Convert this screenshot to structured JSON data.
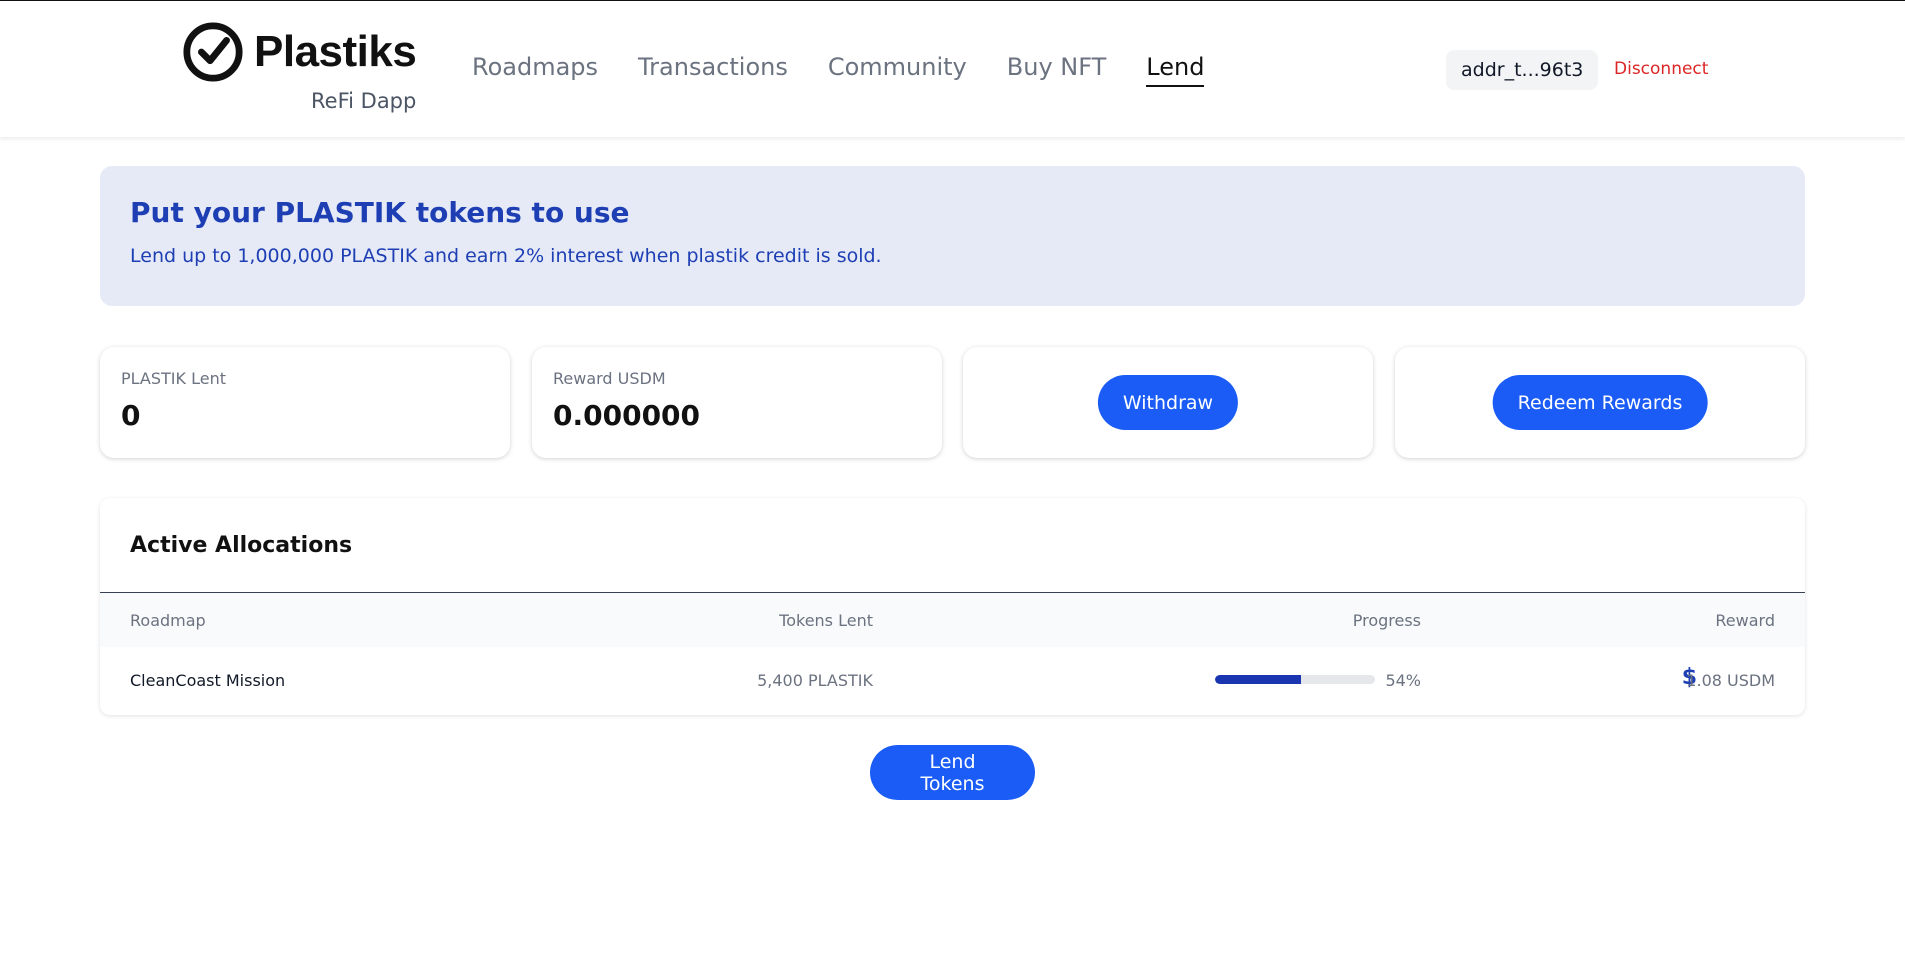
{
  "brand": {
    "name": "Plastiks",
    "subtitle": "ReFi Dapp"
  },
  "nav": {
    "items": [
      {
        "label": "Roadmaps",
        "active": false
      },
      {
        "label": "Transactions",
        "active": false
      },
      {
        "label": "Community",
        "active": false
      },
      {
        "label": "Buy NFT",
        "active": false
      },
      {
        "label": "Lend",
        "active": true
      }
    ]
  },
  "wallet": {
    "address": "addr_t...96t3",
    "disconnect_label": "Disconnect"
  },
  "banner": {
    "title": "Put your PLASTIK tokens to use",
    "text": "Lend up to 1,000,000 PLASTIK and earn 2% interest when plastik credit is sold."
  },
  "stats": {
    "lent_label": "PLASTIK Lent",
    "lent_value": "0",
    "reward_label": "Reward USDM",
    "reward_value": "0.000000"
  },
  "actions": {
    "withdraw_label": "Withdraw",
    "redeem_label": "Redeem Rewards",
    "lend_label": "Lend Tokens"
  },
  "allocations": {
    "title": "Active Allocations",
    "columns": {
      "roadmap": "Roadmap",
      "tokens": "Tokens Lent",
      "progress": "Progress",
      "reward": "Reward"
    },
    "rows": [
      {
        "roadmap": "CleanCoast Mission",
        "tokens": "5,400 PLASTIK",
        "progress_value": 0.54,
        "progress_text": "54%",
        "reward": "1.08 USDM",
        "reward_icon": "dollar-icon"
      }
    ]
  },
  "colors": {
    "accent": "#1a5cf5",
    "brand_blue": "#1e3fb4",
    "banner_bg": "#e6eaf6",
    "danger": "#dc2626"
  }
}
